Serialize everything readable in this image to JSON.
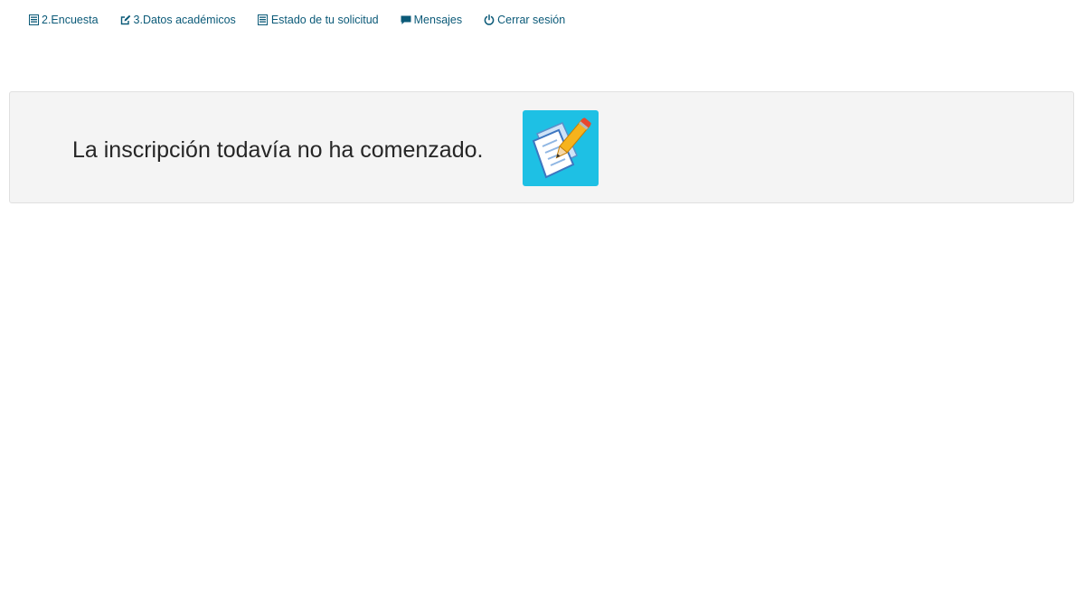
{
  "nav": {
    "items": [
      {
        "label": "2.Encuesta",
        "icon": "list-icon"
      },
      {
        "label": "3.Datos académicos",
        "icon": "edit-icon"
      },
      {
        "label": "Estado de tu solicitud",
        "icon": "list-icon"
      },
      {
        "label": "Mensajes",
        "icon": "comment-icon"
      },
      {
        "label": "Cerrar sesión",
        "icon": "power-icon"
      }
    ]
  },
  "panel": {
    "message": "La inscripción todavía no ha comenzado.",
    "image_icon": "document-pencil-icon"
  },
  "colors": {
    "link": "#0b5a78",
    "panel_bg": "#f4f4f4",
    "icon_tile": "#1ec0e4"
  }
}
